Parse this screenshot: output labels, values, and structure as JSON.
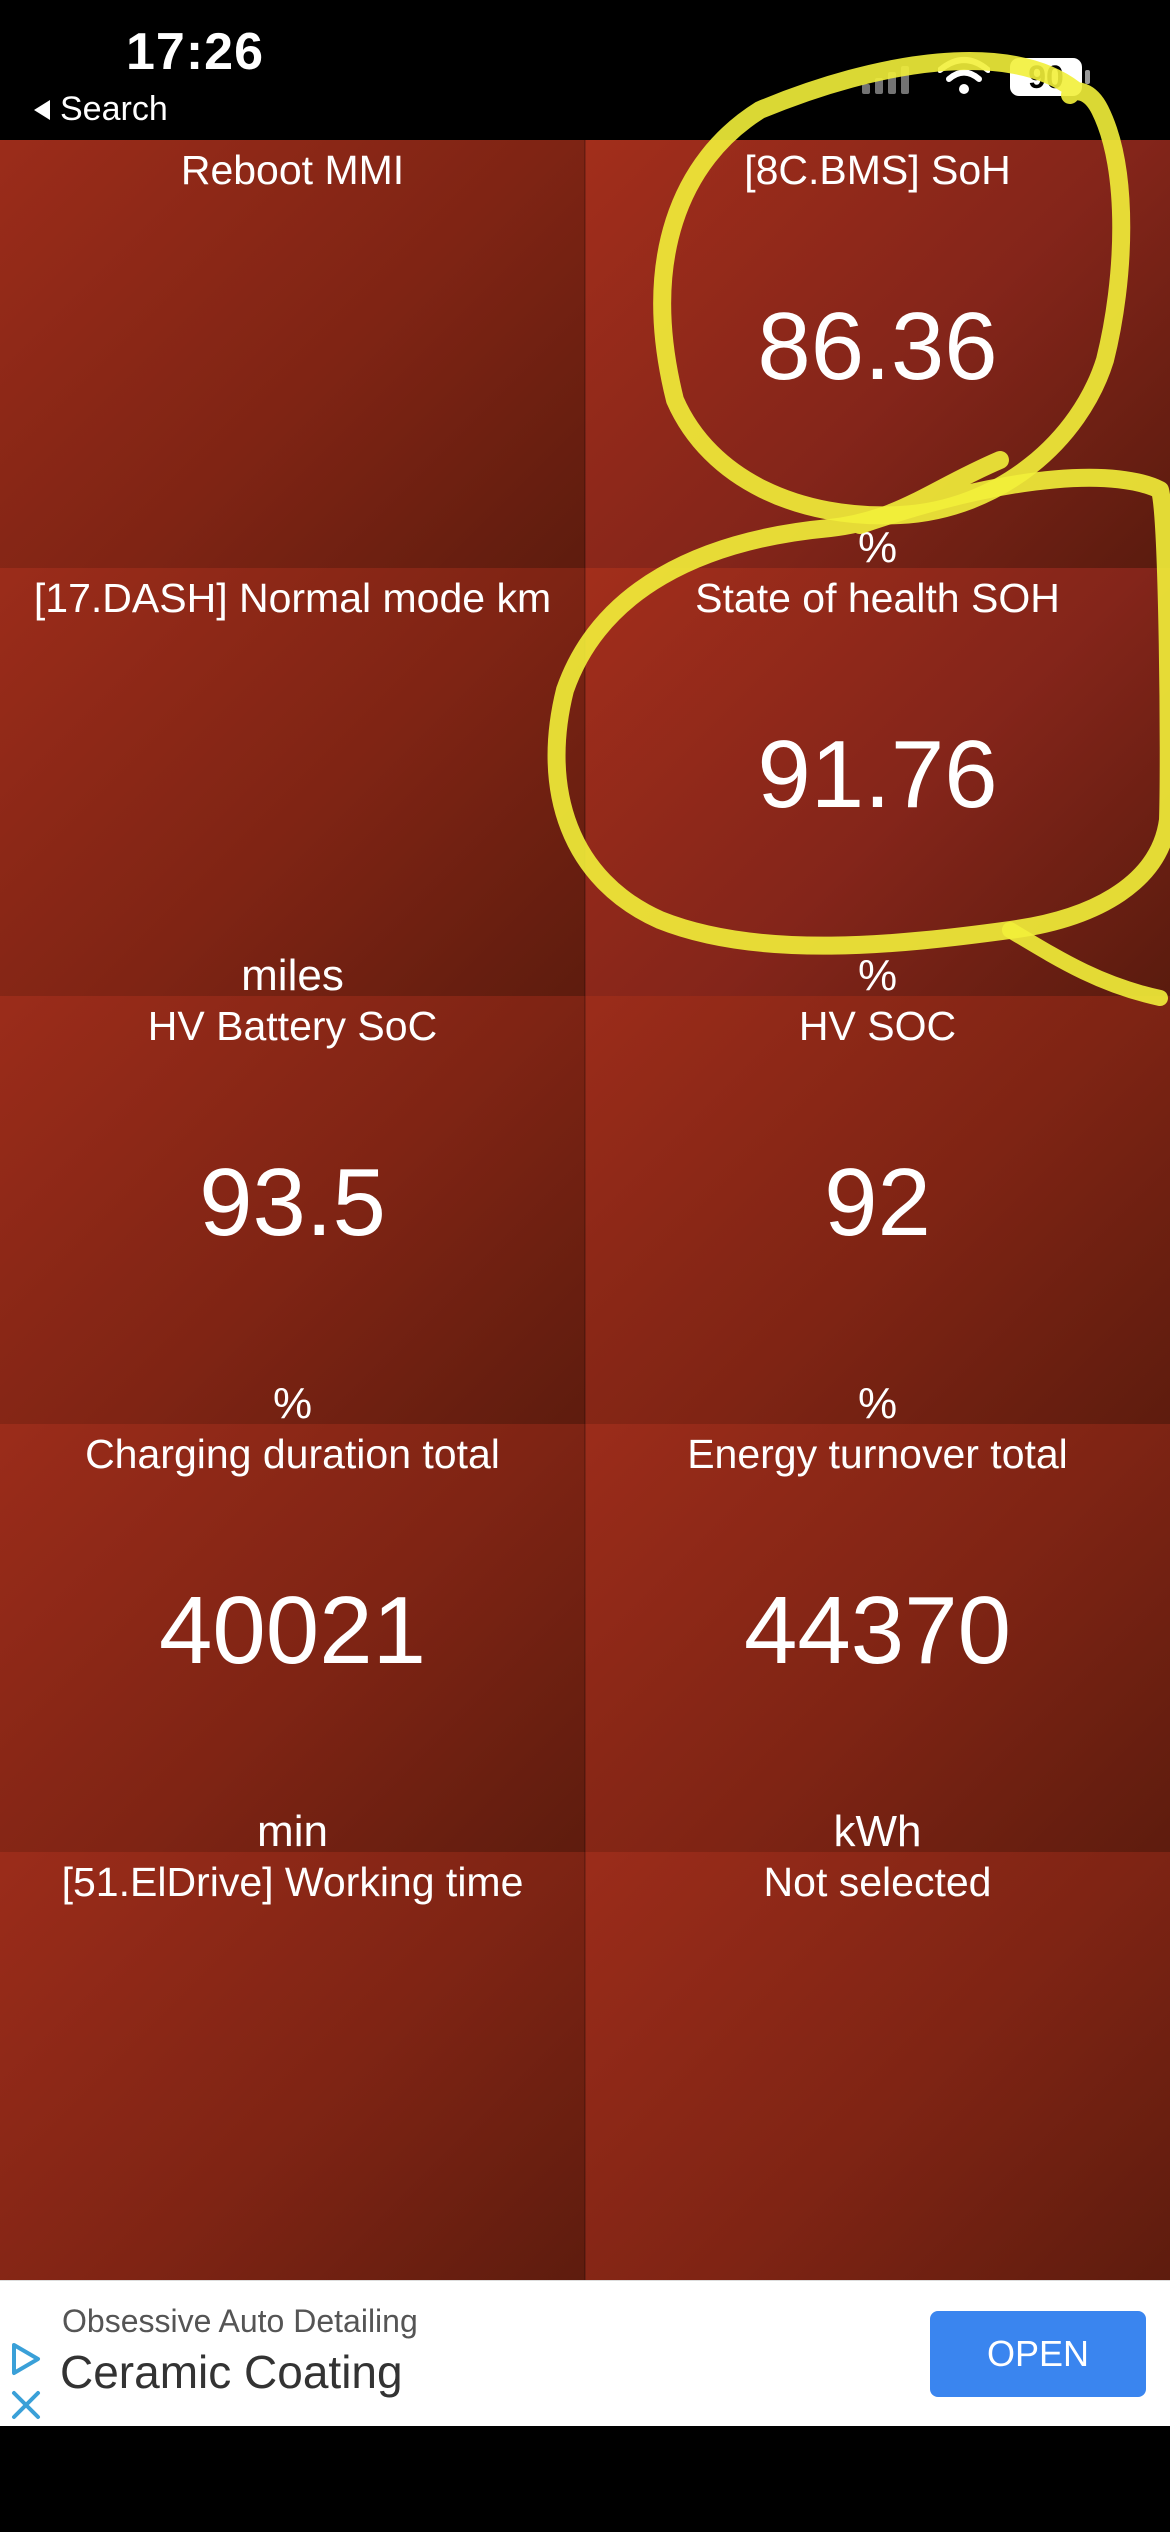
{
  "status_bar": {
    "time": "17:26",
    "back_label": "Search",
    "battery": "90"
  },
  "tiles": [
    {
      "title": "Reboot MMI",
      "value": "",
      "unit": ""
    },
    {
      "title": "[8C.BMS] SoH",
      "value": "86.36",
      "unit": "%"
    },
    {
      "title": "[17.DASH] Normal mode km",
      "value": "",
      "unit": "miles"
    },
    {
      "title": "State of health SOH",
      "value": "91.76",
      "unit": "%"
    },
    {
      "title": "HV Battery SoC",
      "value": "93.5",
      "unit": "%"
    },
    {
      "title": "HV SOC",
      "value": "92",
      "unit": "%"
    },
    {
      "title": "Charging duration total",
      "value": "40021",
      "unit": "min"
    },
    {
      "title": "Energy turnover total",
      "value": "44370",
      "unit": "kWh"
    },
    {
      "title": "[51.ElDrive] Working time",
      "value": "",
      "unit": ""
    },
    {
      "title": "Not selected",
      "value": "",
      "unit": ""
    }
  ],
  "ad": {
    "advertiser": "Obsessive Auto Detailing",
    "headline": "Ceramic Coating",
    "cta": "OPEN"
  },
  "colors": {
    "tile": "#8b2816",
    "highlight": "#f2ef3a",
    "cta": "#3a85ef"
  }
}
